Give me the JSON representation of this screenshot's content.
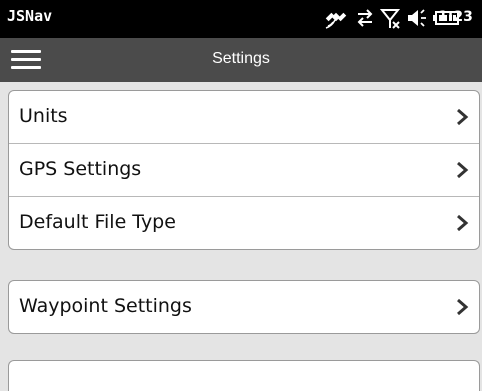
{
  "app": {
    "name": "JSNav",
    "clock": "1:23"
  },
  "header": {
    "title": "Settings"
  },
  "status_icons": [
    "satellite-icon",
    "data-transfer-icon",
    "no-signal-icon",
    "volume-icon",
    "battery-icon"
  ],
  "groups": [
    {
      "items": [
        {
          "label": "Units"
        },
        {
          "label": "GPS Settings"
        },
        {
          "label": "Default File Type"
        }
      ]
    },
    {
      "items": [
        {
          "label": "Waypoint Settings"
        }
      ]
    }
  ]
}
